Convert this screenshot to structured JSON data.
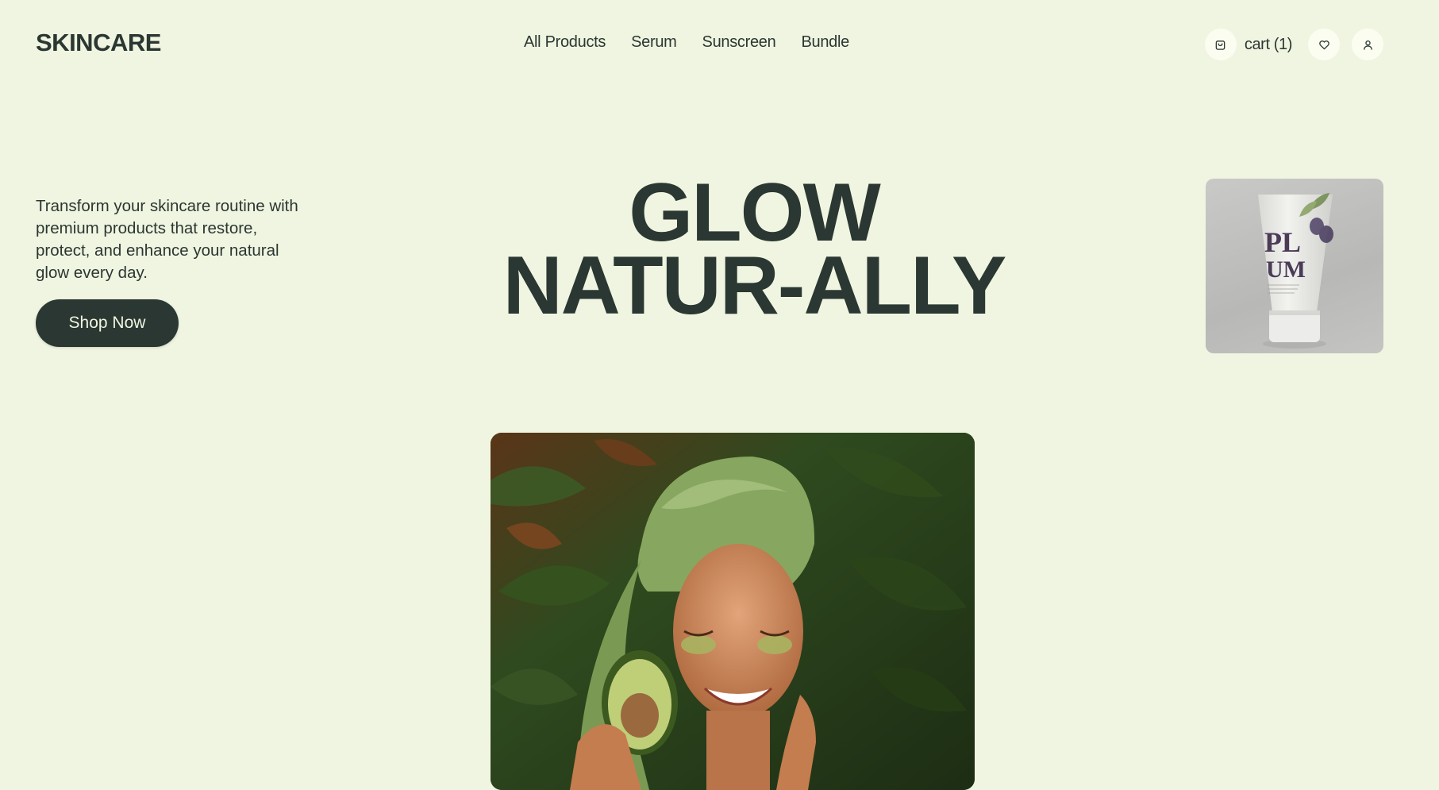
{
  "header": {
    "brand": "SKINCARE",
    "nav": [
      "All Products",
      "Serum",
      "Sunscreen",
      "Bundle"
    ],
    "cart_label": "cart (1)"
  },
  "hero": {
    "intro": "Transform your skincare routine with premium products that restore, protect, and enhance your natural glow every day.",
    "cta": "Shop Now",
    "headline_line1": "GLOW",
    "headline_line2": "NATUR-ALLY"
  },
  "product_thumb": {
    "label_top": "PL",
    "label_bottom": "UM"
  },
  "icons": {
    "cart": "shopping-bag-icon",
    "wishlist": "heart-icon",
    "account": "user-icon"
  },
  "colors": {
    "background": "#f0f5e1",
    "primary_text": "#2b3732",
    "button_bg": "#2b3732",
    "icon_circle": "#fcfdf1"
  }
}
